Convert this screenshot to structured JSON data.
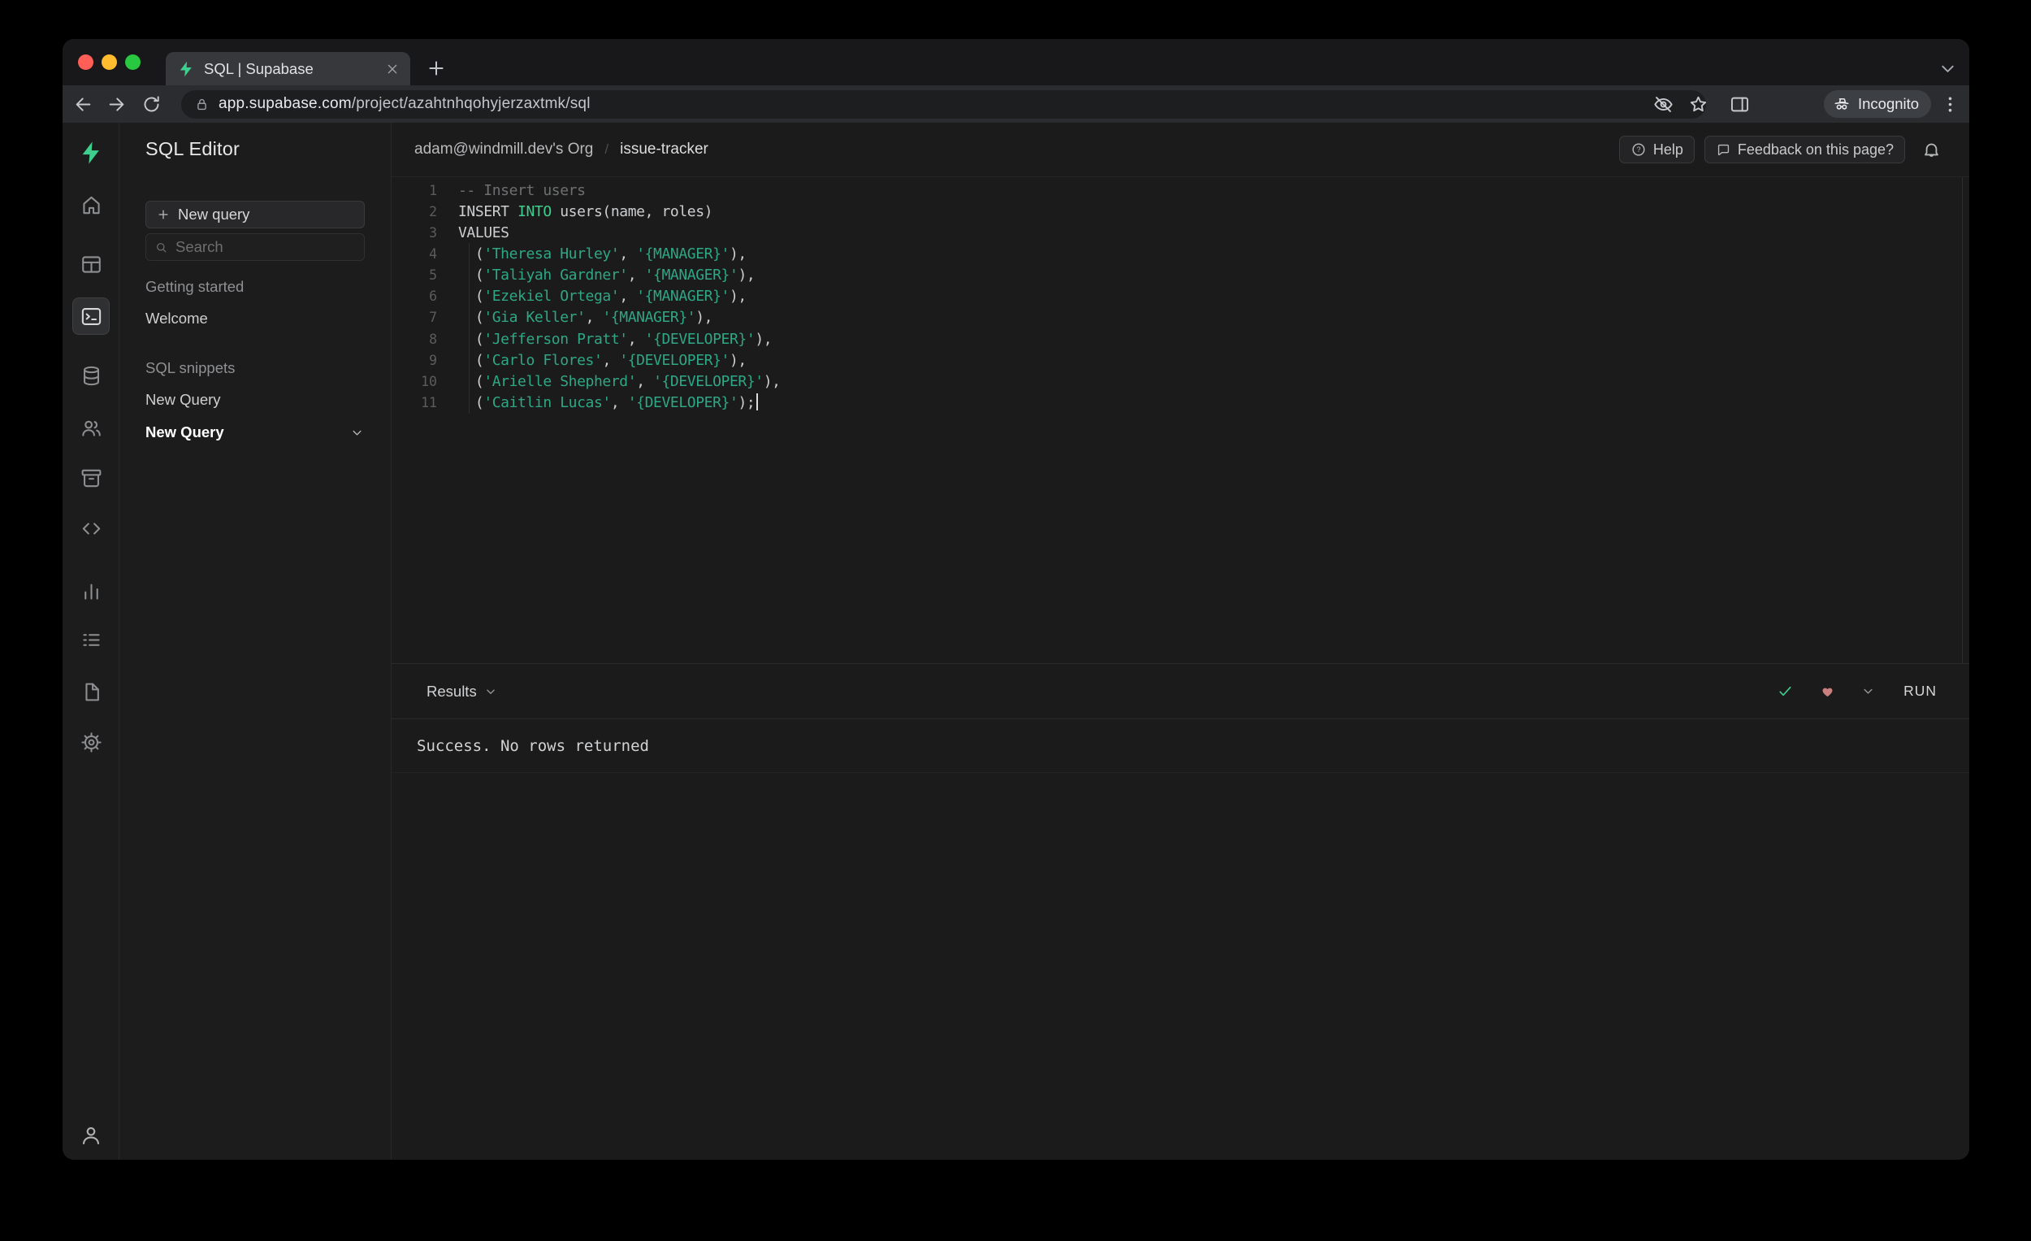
{
  "browser": {
    "tab_title": "SQL | Supabase",
    "url_domain": "app.supabase.com",
    "url_path": "/project/azahtnhqohyjerzaxtmk/sql",
    "incognito_label": "Incognito"
  },
  "rail": {
    "items": [
      "home",
      "table-editor",
      "sql-editor",
      "database",
      "auth-users",
      "storage",
      "code",
      "reports",
      "logs",
      "docs",
      "settings"
    ],
    "active": "sql-editor"
  },
  "sidebar": {
    "title": "SQL Editor",
    "new_query_label": "New query",
    "search_placeholder": "Search",
    "sections": [
      {
        "label": "Getting started",
        "items": [
          {
            "label": "Welcome"
          }
        ]
      },
      {
        "label": "SQL snippets",
        "items": [
          {
            "label": "New Query"
          },
          {
            "label": "New Query",
            "active": true,
            "has_chevron": true
          }
        ]
      }
    ]
  },
  "header": {
    "breadcrumb": [
      "adam@windmill.dev's Org",
      "issue-tracker"
    ],
    "separator": "/",
    "help_label": "Help",
    "feedback_label": "Feedback on this page?"
  },
  "editor": {
    "cursor_line": 11,
    "lines": [
      {
        "num": 1,
        "segments": [
          {
            "t": "-- Insert users",
            "c": "c"
          }
        ]
      },
      {
        "num": 2,
        "segments": [
          {
            "t": "INSERT ",
            "c": "d"
          },
          {
            "t": "INTO",
            "c": "k"
          },
          {
            "t": " users(name, roles)",
            "c": "d"
          }
        ]
      },
      {
        "num": 3,
        "segments": [
          {
            "t": "VALUES",
            "c": "d"
          }
        ]
      },
      {
        "num": 4,
        "segments": [
          {
            "t": "  (",
            "c": "d"
          },
          {
            "t": "'Theresa Hurley'",
            "c": "s"
          },
          {
            "t": ", ",
            "c": "d"
          },
          {
            "t": "'{MANAGER}'",
            "c": "s"
          },
          {
            "t": "),",
            "c": "d"
          }
        ]
      },
      {
        "num": 5,
        "segments": [
          {
            "t": "  (",
            "c": "d"
          },
          {
            "t": "'Taliyah Gardner'",
            "c": "s"
          },
          {
            "t": ", ",
            "c": "d"
          },
          {
            "t": "'{MANAGER}'",
            "c": "s"
          },
          {
            "t": "),",
            "c": "d"
          }
        ]
      },
      {
        "num": 6,
        "segments": [
          {
            "t": "  (",
            "c": "d"
          },
          {
            "t": "'Ezekiel Ortega'",
            "c": "s"
          },
          {
            "t": ", ",
            "c": "d"
          },
          {
            "t": "'{MANAGER}'",
            "c": "s"
          },
          {
            "t": "),",
            "c": "d"
          }
        ]
      },
      {
        "num": 7,
        "segments": [
          {
            "t": "  (",
            "c": "d"
          },
          {
            "t": "'Gia Keller'",
            "c": "s"
          },
          {
            "t": ", ",
            "c": "d"
          },
          {
            "t": "'{MANAGER}'",
            "c": "s"
          },
          {
            "t": "),",
            "c": "d"
          }
        ]
      },
      {
        "num": 8,
        "segments": [
          {
            "t": "  (",
            "c": "d"
          },
          {
            "t": "'Jefferson Pratt'",
            "c": "s"
          },
          {
            "t": ", ",
            "c": "d"
          },
          {
            "t": "'{DEVELOPER}'",
            "c": "s"
          },
          {
            "t": "),",
            "c": "d"
          }
        ]
      },
      {
        "num": 9,
        "segments": [
          {
            "t": "  (",
            "c": "d"
          },
          {
            "t": "'Carlo Flores'",
            "c": "s"
          },
          {
            "t": ", ",
            "c": "d"
          },
          {
            "t": "'{DEVELOPER}'",
            "c": "s"
          },
          {
            "t": "),",
            "c": "d"
          }
        ]
      },
      {
        "num": 10,
        "segments": [
          {
            "t": "  (",
            "c": "d"
          },
          {
            "t": "'Arielle Shepherd'",
            "c": "s"
          },
          {
            "t": ", ",
            "c": "d"
          },
          {
            "t": "'{DEVELOPER}'",
            "c": "s"
          },
          {
            "t": "),",
            "c": "d"
          }
        ]
      },
      {
        "num": 11,
        "segments": [
          {
            "t": "  (",
            "c": "d"
          },
          {
            "t": "'Caitlin Lucas'",
            "c": "s"
          },
          {
            "t": ", ",
            "c": "d"
          },
          {
            "t": "'{DEVELOPER}'",
            "c": "s"
          },
          {
            "t": ");",
            "c": "d"
          }
        ]
      }
    ]
  },
  "results": {
    "label": "Results",
    "run_label": "RUN",
    "message": "Success. No rows returned"
  },
  "colors": {
    "brand_green": "#3ecf8e",
    "keyword": "#3ecf8e",
    "string": "#2fa784",
    "comment": "#6e6f71",
    "traffic_close": "#ff5f57",
    "traffic_minimize": "#febc2e",
    "traffic_zoom": "#28c840"
  }
}
